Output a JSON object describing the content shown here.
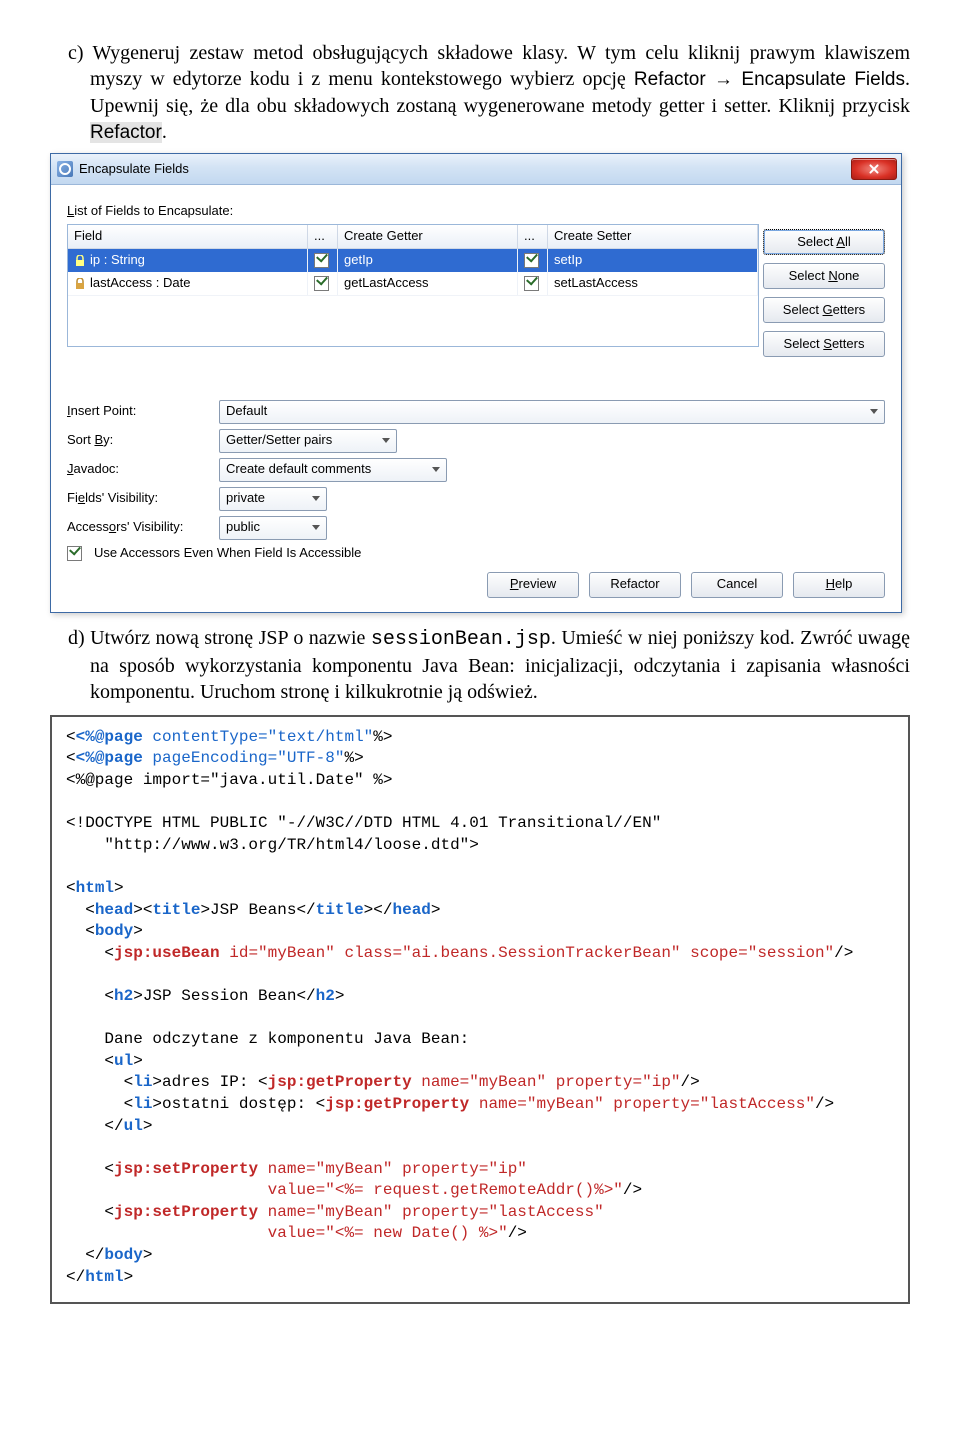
{
  "para_c": "c) Wygeneruj zestaw metod obsługujących składowe klasy. W tym celu kliknij prawym klawiszem myszy w edytorze kodu i z menu kontekstowego wybierz opcję ",
  "refactor_menu": "Refactor → Encapsulate Fields",
  "para_c2": ". Upewnij się, że dla obu składowych zostaną wygenerowane metody getter i setter. Kliknij przycisk ",
  "refactor_btn_txt": "Refactor",
  "dot": ".",
  "dialog": {
    "title": "Encapsulate Fields",
    "list_label": "List of Fields to Encapsulate:",
    "headers": {
      "field": "Field",
      "dots": "...",
      "getter": "Create Getter",
      "setter": "Create Setter"
    },
    "rows": [
      {
        "field": "ip : String",
        "getter": "getIp",
        "setter": "setIp",
        "selected": true
      },
      {
        "field": "lastAccess : Date",
        "getter": "getLastAccess",
        "setter": "setLastAccess",
        "selected": false
      }
    ],
    "side": {
      "all": "Select All",
      "none": "Select None",
      "getters": "Select Getters",
      "setters": "Select Setters"
    },
    "insert_point": {
      "label": "Insert Point:",
      "value": "Default"
    },
    "sort_by": {
      "label": "Sort By:",
      "value": "Getter/Setter pairs"
    },
    "javadoc": {
      "label": "Javadoc:",
      "value": "Create default comments"
    },
    "fields_vis": {
      "label": "Fields' Visibility:",
      "value": "private"
    },
    "acc_vis": {
      "label": "Accessors' Visibility:",
      "value": "public"
    },
    "use_acc": "Use Accessors Even When Field Is Accessible",
    "buttons": {
      "preview": "Preview",
      "refactor": "Refactor",
      "cancel": "Cancel",
      "help": "Help"
    }
  },
  "para_d1": "d) Utwórz nową stronę JSP o nazwie ",
  "sessionbean": "sessionBean.jsp",
  "para_d2": ". Umieść w niej poniższy kod. Zwróć uwagę na sposób wykorzystania komponentu Java Bean: inicjalizacji, odczytania i zapisania własności komponentu. Uruchom stronę i kilkukrotnie ją odśwież.",
  "code": {
    "page1_a": "<%@page",
    "page1_b": " contentType=",
    "page1_c": "\"text/html\"",
    "page1_d": "%>",
    "page2_a": "<%@page",
    "page2_b": " pageEncoding=",
    "page2_c": "\"UTF-8\"",
    "page2_d": "%>",
    "page3": "<%@page import=\"java.util.Date\" %>",
    "doctype1": "<!DOCTYPE HTML PUBLIC \"-//W3C//DTD HTML 4.01 Transitional//EN\"",
    "doctype2": "    \"http://www.w3.org/TR/html4/loose.dtd\">",
    "html_o": "<",
    "html": "html",
    "gt": ">",
    "head_o": "<",
    "head": "head",
    "title": "title",
    "jspbeans": "JSP Beans",
    "body": "body",
    "usebean": "jsp:useBean",
    "id": " id=",
    "q1": "\"myBean\"",
    "cls": " class=",
    "q2": "\"ai.beans.SessionTrackerBean\"",
    "scope": " scope=",
    "q3": "\"session\"",
    "sc": "/>",
    "h2": "h2",
    "h2txt": "JSP Session Bean",
    "dane": "Dane odczytane z komponentu Java Bean:",
    "ul": "ul",
    "li": "li",
    "adres": "adres IP: ",
    "getprop": "jsp:getProperty",
    "name": " name=",
    "prop": " property=",
    "qip": "\"ip\"",
    "ostatni": "ostatni dostęp: ",
    "qla": "\"lastAccess\"",
    "setprop": "jsp:setProperty",
    "val": "value=",
    "valip": "\"<%= request.getRemoteAddr()%>\"",
    "valla": "\"<%= new Date() %>\""
  }
}
